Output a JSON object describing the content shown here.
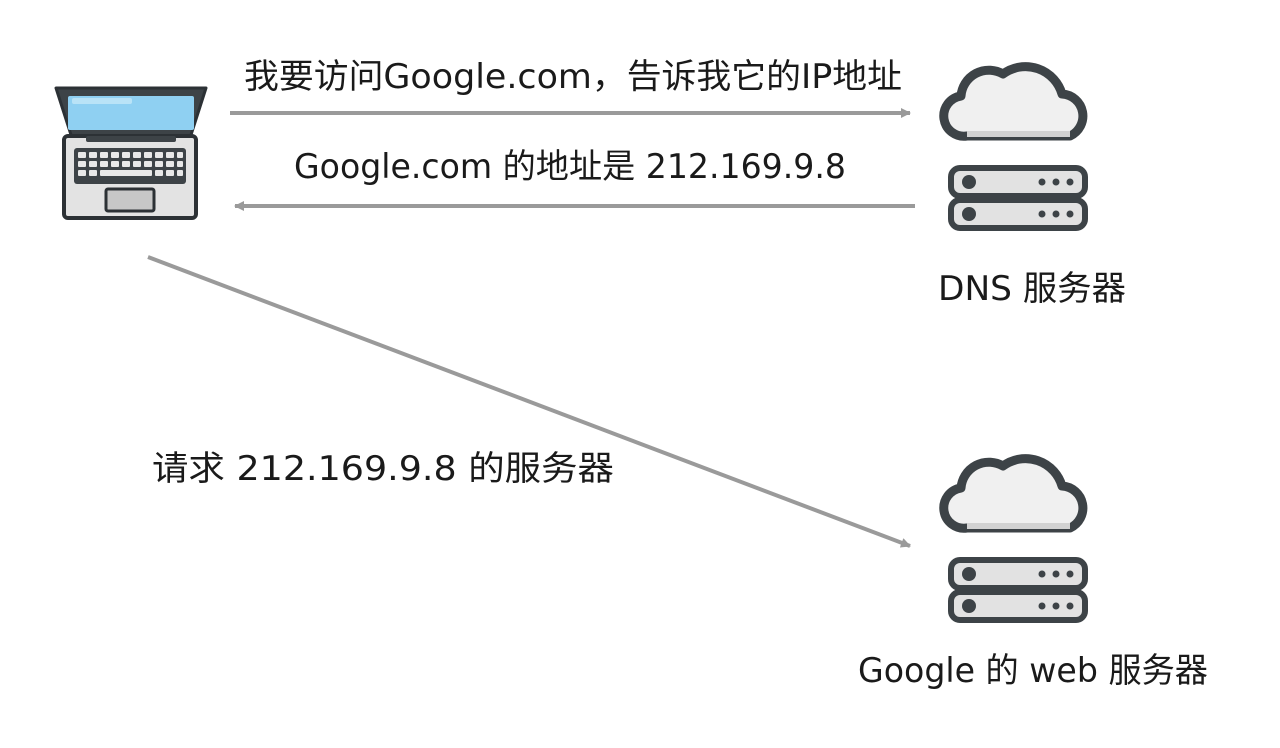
{
  "arrows": {
    "query_label": "我要访问Google.com，告诉我它的IP地址",
    "reply_label": "Google.com 的地址是 212.169.9.8",
    "request_label": "请求 212.169.9.8 的服务器"
  },
  "nodes": {
    "client": {
      "icon": "laptop-icon"
    },
    "dns_server": {
      "icon": "cloud-server-icon",
      "label": "DNS 服务器"
    },
    "web_server": {
      "icon": "cloud-server-icon",
      "label": "Google 的 web 服务器"
    }
  },
  "colors": {
    "arrow": "#9a9a9a",
    "outline": "#3d4347",
    "laptop_screen": "#8fd0f2",
    "laptop_body": "#e3e3e3",
    "cloud_fill": "#f0f0f0",
    "server_fill": "#e2e2e2",
    "text": "#1a1a1a"
  }
}
